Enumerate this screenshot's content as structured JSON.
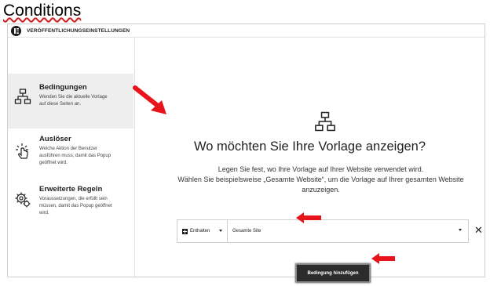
{
  "heading": "Conditions",
  "window": {
    "title": "VERÖFFENTLICHUNGSEINSTELLUNGEN"
  },
  "sidebar": {
    "items": [
      {
        "title": "Bedingungen",
        "desc_lines": [
          "Wenden Sie die aktuelle Vorlage",
          "auf diese Seiten an."
        ],
        "icon": "sitemap-icon"
      },
      {
        "title": "Auslöser",
        "desc_lines": [
          "Welche Aktion der Benutzer",
          "ausführen muss, damit das Popup",
          "geöffnet wird."
        ],
        "icon": "click-icon"
      },
      {
        "title": "Erweiterte Regeln",
        "desc_lines": [
          "Voraussetzungen, die erfüllt sein",
          "müssen, damit das Popup geöffnet",
          "wird."
        ],
        "icon": "gears-icon"
      }
    ]
  },
  "main": {
    "title": "Wo möchten Sie Ihre Vorlage anzeigen?",
    "desc_lines": [
      "Legen Sie fest, wo Ihre Vorlage auf Ihrer Website verwendet wird.",
      "Wählen Sie beispielsweise „Gesamte Website“, um die Vorlage auf Ihrer gesamten Website",
      "anzuzeigen."
    ],
    "condition": {
      "type": "Enthalten",
      "value": "Gesamte Site"
    },
    "remove_glyph": "✕",
    "add_button": "Bedingung hinzufügen"
  },
  "colors": {
    "annotation_arrow": "#e8141b",
    "button_bg": "#2c2c2c",
    "active_item_bg": "#eeeeee"
  }
}
